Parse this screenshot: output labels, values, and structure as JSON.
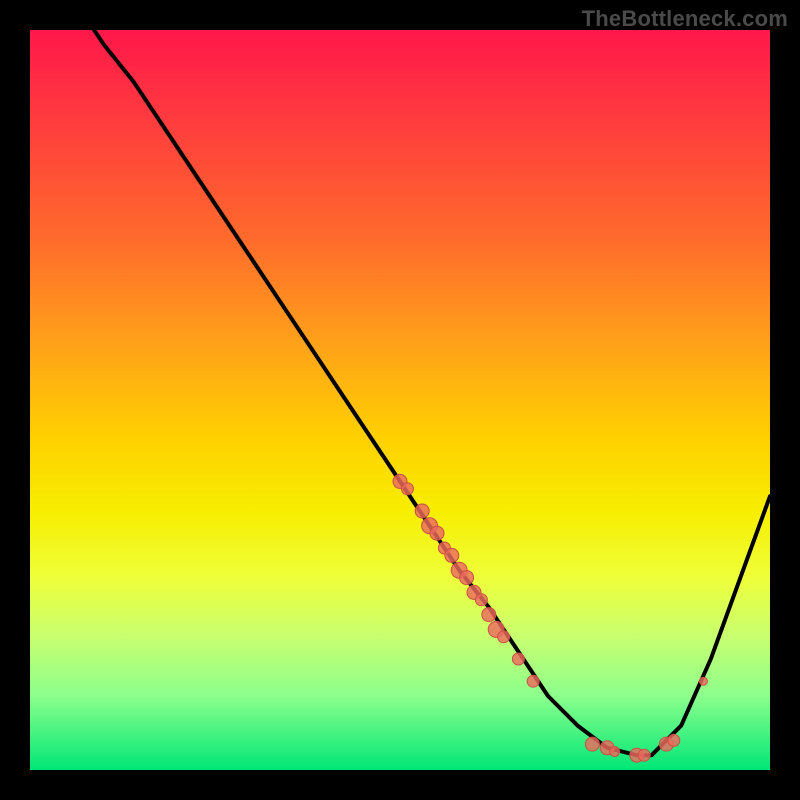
{
  "watermark": "TheBottleneck.com",
  "palette": {
    "gradient_top": "#ff184a",
    "gradient_bottom": "#00e676",
    "curve": "#000000",
    "marker_fill": "#ec6a5e",
    "marker_stroke": "#c94f44"
  },
  "chart_data": {
    "type": "line",
    "title": "",
    "xlabel": "",
    "ylabel": "",
    "xlim": [
      0,
      100
    ],
    "ylim": [
      0,
      100
    ],
    "grid": false,
    "legend": false,
    "series": [
      {
        "name": "bottleneck-curve",
        "x": [
          0,
          4,
          8,
          10,
          14,
          18,
          22,
          26,
          30,
          34,
          38,
          42,
          46,
          50,
          54,
          58,
          62,
          66,
          70,
          74,
          78,
          82,
          84,
          88,
          92,
          96,
          100
        ],
        "y": [
          110,
          105,
          101,
          98,
          93,
          87,
          81,
          75,
          69,
          63,
          57,
          51,
          45,
          39,
          33,
          27,
          22,
          16,
          10,
          6,
          3,
          2,
          2,
          6,
          15,
          26,
          37
        ]
      }
    ],
    "markers": [
      {
        "x": 50,
        "y": 39,
        "r": 7
      },
      {
        "x": 51,
        "y": 38,
        "r": 6
      },
      {
        "x": 53,
        "y": 35,
        "r": 7
      },
      {
        "x": 54,
        "y": 33,
        "r": 8
      },
      {
        "x": 55,
        "y": 32,
        "r": 7
      },
      {
        "x": 56,
        "y": 30,
        "r": 6
      },
      {
        "x": 57,
        "y": 29,
        "r": 7
      },
      {
        "x": 58,
        "y": 27,
        "r": 8
      },
      {
        "x": 59,
        "y": 26,
        "r": 7
      },
      {
        "x": 60,
        "y": 24,
        "r": 7
      },
      {
        "x": 61,
        "y": 23,
        "r": 6
      },
      {
        "x": 62,
        "y": 21,
        "r": 7
      },
      {
        "x": 63,
        "y": 19,
        "r": 8
      },
      {
        "x": 64,
        "y": 18,
        "r": 6
      },
      {
        "x": 66,
        "y": 15,
        "r": 6
      },
      {
        "x": 68,
        "y": 12,
        "r": 6
      },
      {
        "x": 76,
        "y": 3.5,
        "r": 7
      },
      {
        "x": 78,
        "y": 3,
        "r": 7
      },
      {
        "x": 79,
        "y": 2.5,
        "r": 5
      },
      {
        "x": 82,
        "y": 2,
        "r": 7
      },
      {
        "x": 83,
        "y": 2,
        "r": 6
      },
      {
        "x": 86,
        "y": 3.5,
        "r": 7
      },
      {
        "x": 87,
        "y": 4,
        "r": 6
      },
      {
        "x": 91,
        "y": 12,
        "r": 4
      }
    ]
  }
}
